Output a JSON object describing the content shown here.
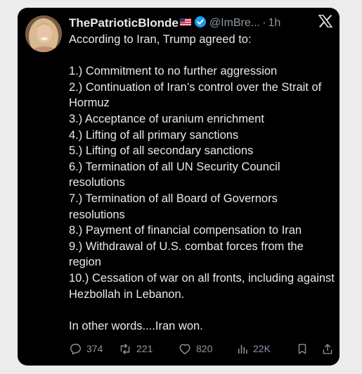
{
  "tweet": {
    "display_name": "ThePatrioticBlonde",
    "handle": "@ImBre...",
    "separator": "·",
    "time": "1h",
    "lines": [
      "According to Iran, Trump agreed to:",
      "",
      "1.) Commitment to no further aggression",
      "2.) Continuation of Iran’s control over the Strait of Hormuz",
      "3.) Acceptance of uranium enrichment",
      "4.) Lifting of all primary sanctions",
      "5.) Lifting of all secondary sanctions",
      "6.) Termination of all UN Security Council resolutions",
      "7.) Termination of all Board of Governors resolutions",
      "8.) Payment of financial compensation to Iran",
      "9.) Withdrawal of U.S. combat forces from the region",
      "10.) Cessation of war on all fronts, including against Hezbollah in Lebanon.",
      "",
      "In other words....Iran won."
    ],
    "stats": {
      "replies": "374",
      "reposts": "221",
      "likes": "820",
      "views": "22K"
    }
  },
  "icons": {
    "verified": "verified-badge-icon",
    "flag": "us-flag-icon",
    "logo": "x-logo-icon",
    "reply": "reply-icon",
    "repost": "repost-icon",
    "like": "heart-icon",
    "views": "views-bar-chart-icon",
    "bookmark": "bookmark-icon",
    "share": "share-icon"
  },
  "colors": {
    "card_background": "#000000",
    "page_background": "#ececec",
    "text": "#e7e9ea",
    "secondary_text": "#8b98a5",
    "verified_blue": "#1d9bf0"
  }
}
